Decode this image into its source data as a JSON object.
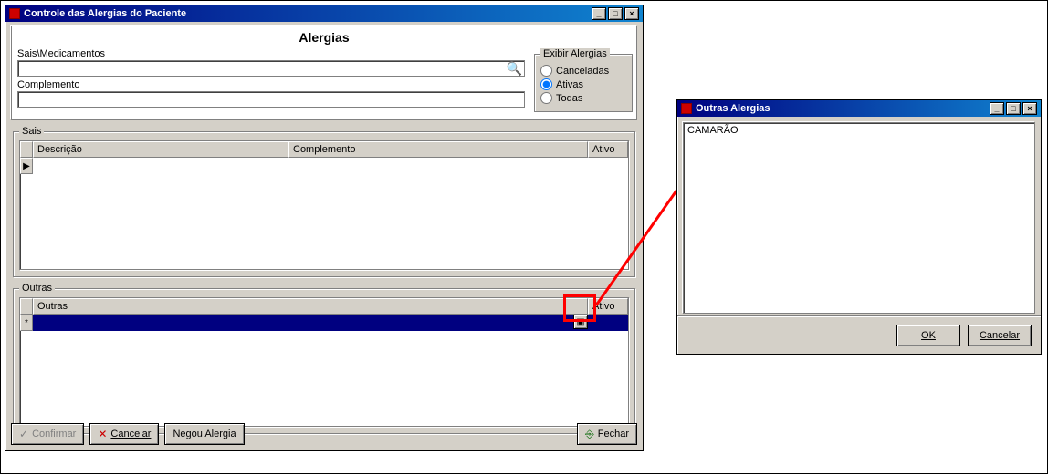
{
  "main_window": {
    "title": "Controle das Alergias do Paciente",
    "section_title": "Alergias",
    "sais_label": "Sais\\Medicamentos",
    "sais_value": "",
    "complemento_top_label": "Complemento",
    "complemento_top_value": "",
    "exibir": {
      "legend": "Exibir Alergias",
      "canceladas": "Canceladas",
      "ativas": "Ativas",
      "todas": "Todas",
      "selected": "ativas"
    },
    "sais_group": {
      "legend": "Sais",
      "cols": {
        "descricao": "Descrição",
        "complemento": "Complemento",
        "ativo": "Ativo"
      }
    },
    "outras_group": {
      "legend": "Outras",
      "cols": {
        "outras": "Outras",
        "ativo": "Ativo"
      }
    },
    "buttons": {
      "confirmar": "Confirmar",
      "cancelar": "Cancelar",
      "negou": "Negou Alergia",
      "fechar": "Fechar"
    }
  },
  "dialog": {
    "title": "Outras Alergias",
    "text": "CAMARÃO",
    "ok": "OK",
    "cancelar": "Cancelar"
  }
}
